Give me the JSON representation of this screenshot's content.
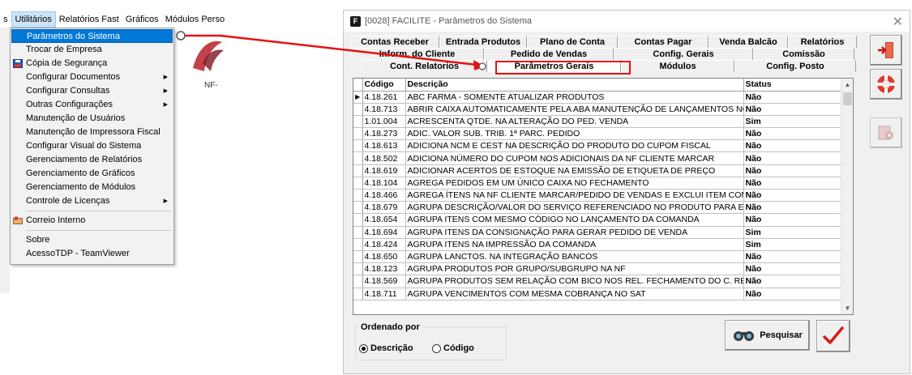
{
  "menubar": {
    "items": [
      "s",
      "Utilitários",
      "Relatórios Fast",
      "Gráficos",
      "Módulos Perso"
    ]
  },
  "dropdown": {
    "items": [
      {
        "label": "Parâmetros do Sistema",
        "highlighted": true
      },
      {
        "label": "Trocar de Empresa"
      },
      {
        "label": "Cópia de Segurança",
        "icon": "disk-icon"
      },
      {
        "label": "Configurar Documentos",
        "submenu": true
      },
      {
        "label": "Configurar Consultas",
        "submenu": true
      },
      {
        "label": "Outras Configurações",
        "submenu": true
      },
      {
        "label": "Manutenção de Usuários"
      },
      {
        "label": "Manutenção de Impressora Fiscal"
      },
      {
        "label": "Configurar Visual do Sistema"
      },
      {
        "label": "Gerenciamento de Relatórios"
      },
      {
        "label": "Gerenciamento de Gráficos"
      },
      {
        "label": "Gerenciamento de Módulos"
      },
      {
        "label": "Controle de Licenças",
        "submenu": true
      },
      {
        "separator": true
      },
      {
        "label": "Correio Interno",
        "icon": "mail-icon"
      },
      {
        "separator": true
      },
      {
        "label": "Sobre"
      },
      {
        "label": "AcessoTDP - TeamViewer"
      }
    ]
  },
  "background": {
    "nfe_text": "NF-"
  },
  "dialog": {
    "icon_letter": "F",
    "title": "[0028] FACILITE - Parâmetros do Sistema",
    "tab_rows": [
      [
        "Contas Receber",
        "Entrada Produtos",
        "Plano de Conta",
        "Contas Pagar",
        "Venda Balcão",
        "Relatórios"
      ],
      [
        "Inform. do Cliente",
        "Pedido de Vendas",
        "Config. Gerais",
        "Comissão"
      ],
      [
        "Cont. Relatorios",
        "Parâmetros Gerais",
        "Módulos",
        "Config. Posto"
      ]
    ],
    "selected_tab": "Parâmetros Gerais",
    "grid": {
      "columns": [
        "Código",
        "Descrição",
        "Status"
      ],
      "rows": [
        [
          "4.18.261",
          "ABC FARMA - SOMENTE ATUALIZAR PRODUTOS",
          "Não"
        ],
        [
          "4.18.713",
          "ABRIR CAIXA AUTOMATICAMENTE PELA ABA MANUTENÇÃO DE LANÇAMENTOS NO MÓDULO",
          "Não"
        ],
        [
          "1.01.004",
          "ACRESCENTA QTDE. NA ALTERAÇÃO DO PED. VENDA",
          "Sim"
        ],
        [
          "4.18.273",
          "ADIC. VALOR SUB. TRIB. 1ª PARC. PEDIDO",
          "Não"
        ],
        [
          "4.18.613",
          "ADICIONA NCM E CEST NA DESCRIÇÃO DO PRODUTO DO CUPOM FISCAL",
          "Não"
        ],
        [
          "4.18.502",
          "ADICIONA NÚMERO DO CUPOM NOS ADICIONAIS DA NF CLIENTE MARCAR",
          "Não"
        ],
        [
          "4.18.619",
          "ADICIONAR ACERTOS DE ESTOQUE NA EMISSÃO DE ETIQUETA DE PREÇO",
          "Não"
        ],
        [
          "4.18.104",
          "AGREGA PEDIDOS EM UM ÚNICO CAIXA NO FECHAMENTO",
          "Não"
        ],
        [
          "4.18.466",
          "AGREGA ÍTENS NA NF CLIENTE MARCAR/PEDIDO DE VENDAS E EXCLUI ITEM COM QUANTIDADE",
          "Não"
        ],
        [
          "4.18.679",
          "AGRUPA DESCRIÇÃO/VALOR DO SERVIÇO REFERENCIADO NO PRODUTO PARA EMISSÃO",
          "Não"
        ],
        [
          "4.18.654",
          "AGRUPA ITENS COM MESMO CÓDIGO NO LANÇAMENTO DA COMANDA",
          "Não"
        ],
        [
          "4.18.694",
          "AGRUPA ITENS DA CONSIGNAÇÃO PARA GERAR PEDIDO DE VENDA",
          "Sim"
        ],
        [
          "4.18.424",
          "AGRUPA ITENS NA IMPRESSÃO DA COMANDA",
          "Sim"
        ],
        [
          "4.18.650",
          "AGRUPA LANCTOS. NA INTEGRAÇÃO BANCOS",
          "Não"
        ],
        [
          "4.18.123",
          "AGRUPA PRODUTOS POR GRUPO/SUBGRUPO NA NF",
          "Não"
        ],
        [
          "4.18.569",
          "AGRUPA PRODUTOS SEM RELAÇÃO COM BICO NOS REL. FECHAMENTO DO C. RECEBER",
          "Não"
        ],
        [
          "4.18.711",
          "AGRUPA VENCIMENTOS COM MESMA COBRANÇA NO SAT",
          "Não"
        ]
      ]
    },
    "order": {
      "legend": "Ordenado por",
      "options": [
        "Descrição",
        "Código"
      ],
      "selected": "Descrição"
    },
    "search_label": "Pesquisar",
    "close_glyph": "✕"
  },
  "colors": {
    "annotation": "#e81010",
    "highlight": "#0078d7"
  }
}
